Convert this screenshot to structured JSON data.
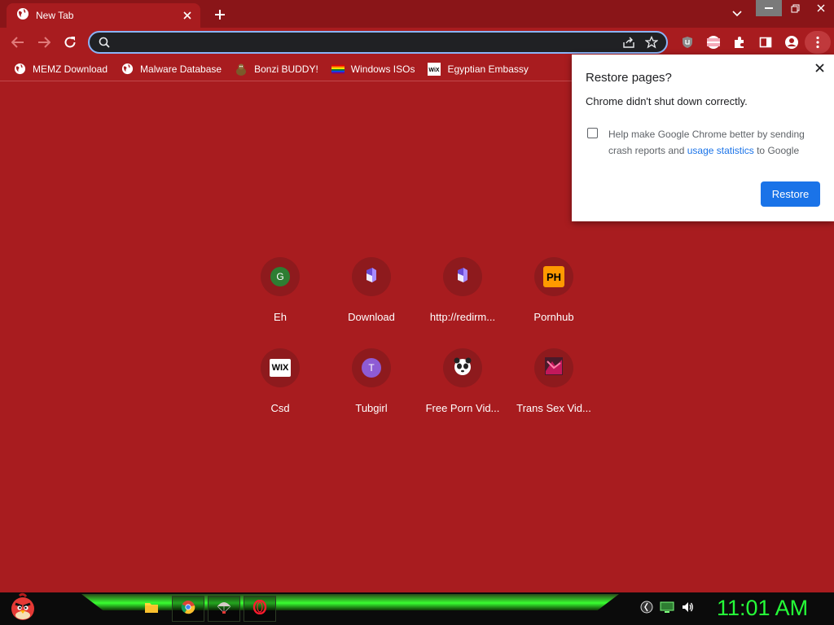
{
  "tab": {
    "title": "New Tab"
  },
  "omnibox": {
    "value": "",
    "placeholder": ""
  },
  "bookmarks": [
    {
      "label": "MEMZ Download",
      "icon": "globe-icon"
    },
    {
      "label": "Malware Database",
      "icon": "globe-icon"
    },
    {
      "label": "Bonzi BUDDY!",
      "icon": "bonzi-icon"
    },
    {
      "label": "Windows ISOs",
      "icon": "rainbow-flag-icon"
    },
    {
      "label": "Egyptian Embassy",
      "icon": "wix-icon"
    }
  ],
  "shortcuts": [
    {
      "label": "Eh",
      "badge": "G",
      "badge_color": "#2e7d32"
    },
    {
      "label": "Download",
      "icon": "mega-icon"
    },
    {
      "label": "http://redirm...",
      "icon": "mega-icon"
    },
    {
      "label": "Pornhub",
      "badge": "PH",
      "badge_color": "#ff9900"
    },
    {
      "label": "Csd",
      "badge": "WIX",
      "badge_color": "#ffffff"
    },
    {
      "label": "Tubgirl",
      "badge": "T",
      "badge_color": "#8e5bd4"
    },
    {
      "label": "Free Porn Vid...",
      "icon": "panda-icon"
    },
    {
      "label": "Trans Sex Vid...",
      "icon": "thumb-icon"
    }
  ],
  "restore_popup": {
    "title": "Restore pages?",
    "message": "Chrome didn't shut down correctly.",
    "consent_before": "Help make Google Chrome better by sending crash reports and ",
    "consent_link": "usage statistics",
    "consent_after": " to Google",
    "restore_label": "Restore"
  },
  "taskbar": {
    "clock": "11:01 AM"
  },
  "colors": {
    "accent": "#1a73e8",
    "page_bg": "#a81c1f",
    "clock": "#25ff38"
  }
}
